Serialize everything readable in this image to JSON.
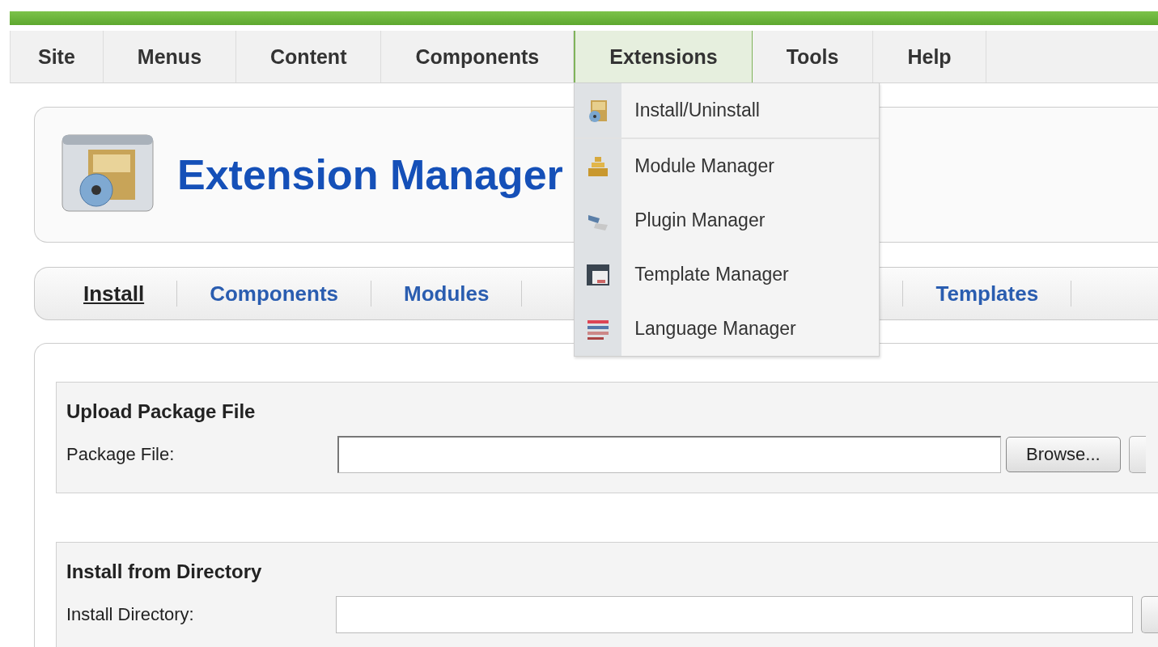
{
  "menu_bar": [
    {
      "label": "Site",
      "selected": false
    },
    {
      "label": "Menus",
      "selected": false
    },
    {
      "label": "Content",
      "selected": false
    },
    {
      "label": "Components",
      "selected": false
    },
    {
      "label": "Extensions",
      "selected": true
    },
    {
      "label": "Tools",
      "selected": false
    },
    {
      "label": "Help",
      "selected": false
    }
  ],
  "dropdown": [
    {
      "label": "Install/Uninstall",
      "kind": "install"
    },
    {
      "label": "Module Manager",
      "kind": "module"
    },
    {
      "label": "Plugin Manager",
      "kind": "plugin"
    },
    {
      "label": "Template Manager",
      "kind": "template"
    },
    {
      "label": "Language Manager",
      "kind": "language"
    }
  ],
  "header": {
    "title": "Extension Manager"
  },
  "subnav": [
    {
      "label": "Install",
      "selected": true
    },
    {
      "label": "Components",
      "selected": false
    },
    {
      "label": "Modules",
      "selected": false
    },
    {
      "label": "Templates",
      "selected": false
    }
  ],
  "sections": [
    {
      "heading": "Upload Package File",
      "label": "Package File:",
      "button": "Browse..."
    },
    {
      "heading": "Install from Directory",
      "label": "Install Directory:"
    }
  ]
}
